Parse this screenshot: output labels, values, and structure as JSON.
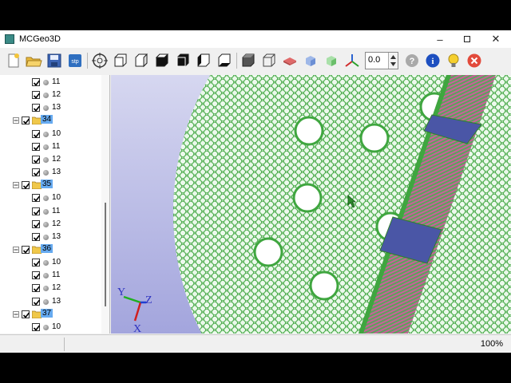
{
  "window": {
    "title": "MCGeo3D"
  },
  "toolbar": {
    "buttons": [
      {
        "name": "new-icon"
      },
      {
        "name": "open-folder-icon"
      },
      {
        "name": "save-icon"
      },
      {
        "name": "step-export-icon"
      },
      {
        "name": "fit-view-icon"
      },
      {
        "name": "view-front-icon"
      },
      {
        "name": "view-back-icon"
      },
      {
        "name": "view-top-icon"
      },
      {
        "name": "view-bottom-icon"
      },
      {
        "name": "view-left-icon"
      },
      {
        "name": "view-right-icon"
      },
      {
        "name": "shaded-mode-icon"
      },
      {
        "name": "wireframe-mode-icon"
      },
      {
        "name": "red-shape-icon"
      },
      {
        "name": "blue-shape-icon"
      },
      {
        "name": "green-shape-icon"
      },
      {
        "name": "axes-icon"
      },
      {
        "name": "help-icon"
      },
      {
        "name": "info-icon"
      },
      {
        "name": "lightbulb-icon"
      },
      {
        "name": "close-red-icon"
      }
    ],
    "zoom_value": "0.0",
    "step_label": "stp"
  },
  "tree": {
    "rows": [
      {
        "type": "item",
        "label": "11"
      },
      {
        "type": "item",
        "label": "12"
      },
      {
        "type": "item",
        "label": "13"
      },
      {
        "type": "group",
        "label": "34"
      },
      {
        "type": "item",
        "label": "10"
      },
      {
        "type": "item",
        "label": "11"
      },
      {
        "type": "item",
        "label": "12"
      },
      {
        "type": "item",
        "label": "13"
      },
      {
        "type": "group",
        "label": "35"
      },
      {
        "type": "item",
        "label": "10"
      },
      {
        "type": "item",
        "label": "11"
      },
      {
        "type": "item",
        "label": "12"
      },
      {
        "type": "item",
        "label": "13"
      },
      {
        "type": "group",
        "label": "36"
      },
      {
        "type": "item",
        "label": "10"
      },
      {
        "type": "item",
        "label": "11"
      },
      {
        "type": "item",
        "label": "12"
      },
      {
        "type": "item",
        "label": "13"
      },
      {
        "type": "group",
        "label": "37"
      },
      {
        "type": "item",
        "label": "10"
      }
    ]
  },
  "axes": {
    "y": "Y",
    "z": "Z",
    "x": "X"
  },
  "status": {
    "zoom": "100%"
  },
  "colors": {
    "background_top": "#d6d7f0",
    "background_bottom": "#a3a5dd",
    "pellet": "#3fa63f",
    "band": "#3f4a9a"
  }
}
